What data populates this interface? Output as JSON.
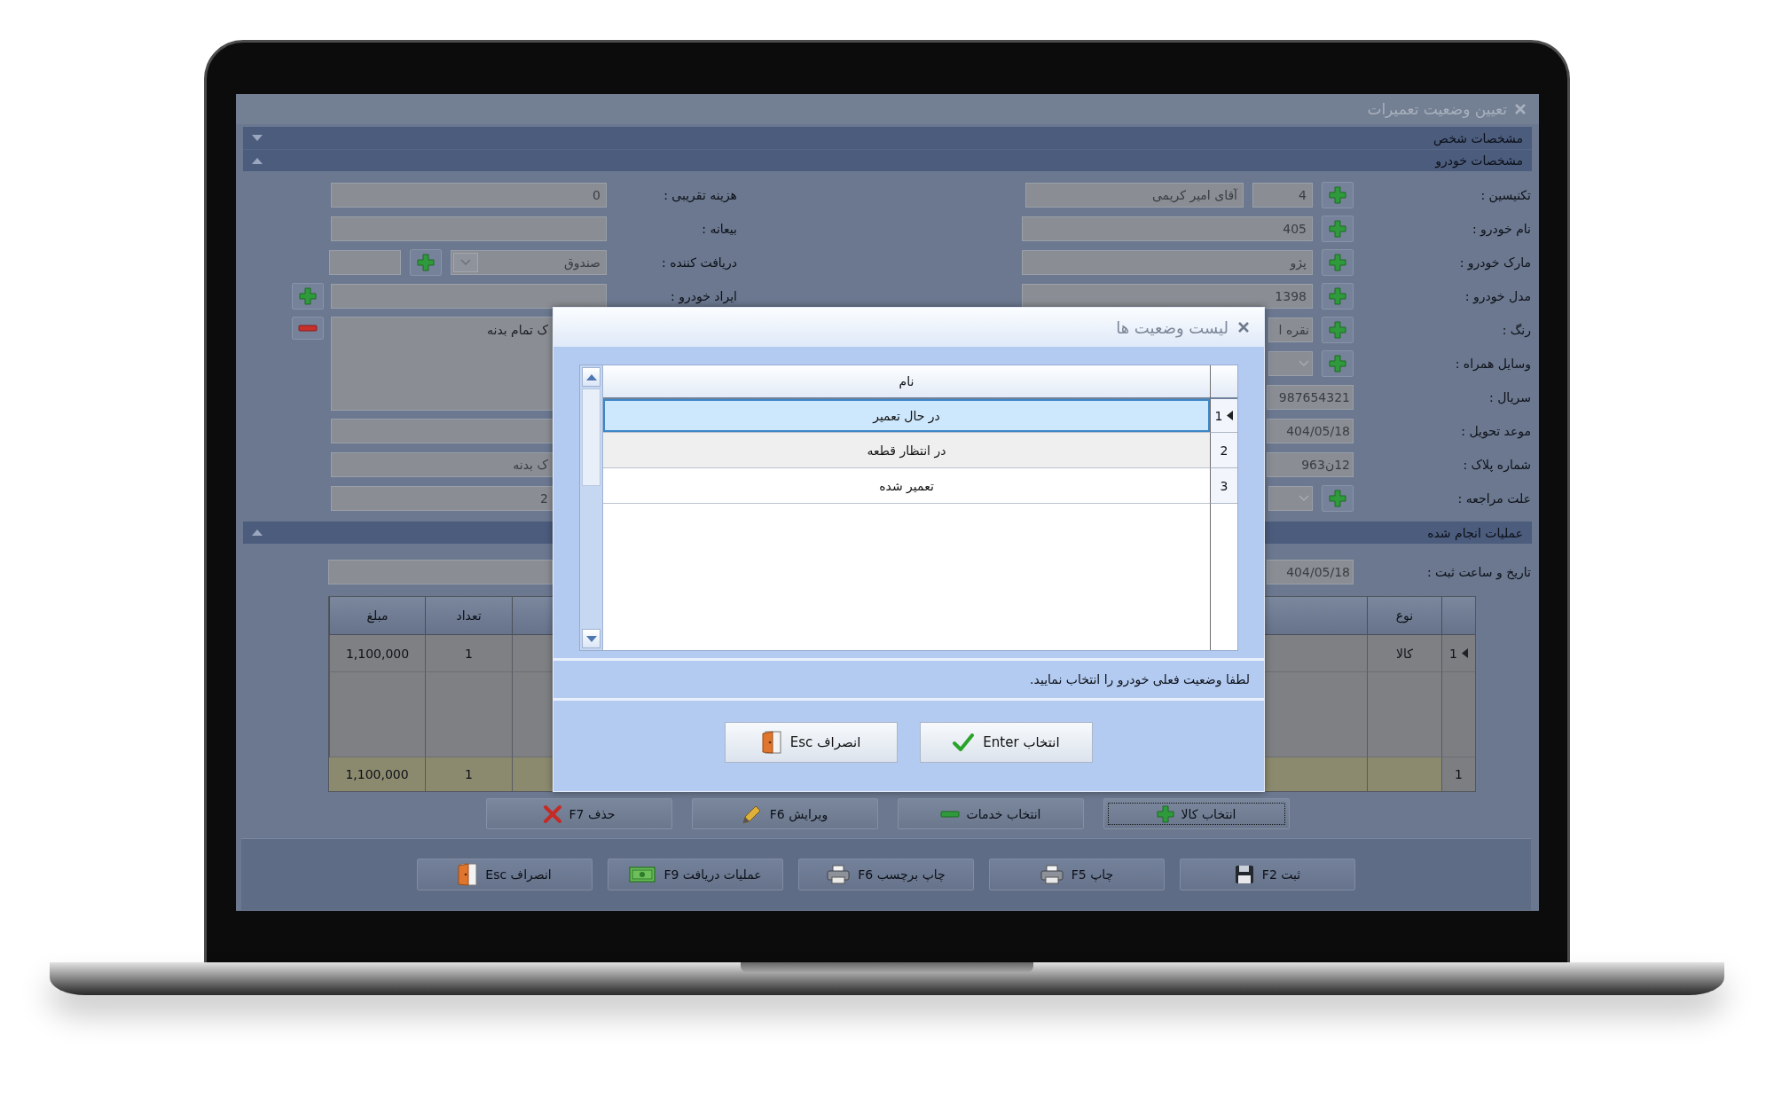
{
  "window": {
    "title": "تعیین وضعیت تعمیرات"
  },
  "sections": [
    {
      "title": "مشخصات شخص",
      "expanded": false
    },
    {
      "title": "مشخصات خودرو",
      "expanded": true
    }
  ],
  "vehicle": {
    "right": [
      {
        "label": "تکنیسین :",
        "kind": "code",
        "code": "4",
        "value": "آقای امیر کریمی",
        "add": true
      },
      {
        "label": "نام خودرو :",
        "kind": "text",
        "value": "405",
        "add": true
      },
      {
        "label": "مارک خودرو :",
        "kind": "text",
        "value": "پژو",
        "add": true
      },
      {
        "label": "مدل خودرو :",
        "kind": "text",
        "value": "1398",
        "add": true
      },
      {
        "label": "رنگ :",
        "kind": "text",
        "value": "نقره ا",
        "add": true
      },
      {
        "label": "وسایل همراه :",
        "kind": "combo",
        "add": true
      },
      {
        "label": "سریال :",
        "kind": "text",
        "value": "987654321",
        "add": false
      },
      {
        "label": "موعد تحویل :",
        "kind": "text",
        "value": "404/05/18",
        "add": false
      },
      {
        "label": "شماره پلاک :",
        "kind": "text",
        "value": "12ن963",
        "add": false
      },
      {
        "label": "علت مراجعه :",
        "kind": "combo",
        "add": true
      }
    ],
    "left": [
      {
        "label": "هزینه تقریبی :",
        "kind": "text",
        "value": "0",
        "add": false
      },
      {
        "label": "بیعانه :",
        "kind": "text",
        "add": false
      },
      {
        "label": "دریافت کننده :",
        "kind": "receiver",
        "value": "صندوق",
        "add": false
      },
      {
        "label": "ایراد خودرو :",
        "kind": "text",
        "add": true
      }
    ],
    "notes": {
      "value": "ک تمام بدنه",
      "removable": true
    },
    "more_fields": [
      {
        "kind": "blank"
      },
      {
        "kind": "text",
        "value": "ک بدنه"
      },
      {
        "kind": "text",
        "value": "2"
      }
    ]
  },
  "operations": {
    "title": "عملیات انجام شده",
    "expanded": true,
    "date_label": "تاریخ و ساعت ثبت :",
    "date_value": "404/05/18",
    "columns": [
      {
        "kind": "label",
        "label": "نوع"
      },
      {
        "kind": "blank"
      },
      {
        "kind": "blank"
      },
      {
        "kind": "label",
        "label": "تعداد"
      },
      {
        "kind": "label",
        "label": "مبلغ"
      }
    ],
    "rows": [
      {
        "number": "1",
        "selected": true,
        "cells": [
          {
            "kind": "text",
            "text": "کالا"
          },
          {
            "kind": "blank"
          },
          {
            "kind": "blank"
          },
          {
            "kind": "text",
            "text": "1"
          },
          {
            "kind": "text",
            "text": "1,100,000"
          }
        ]
      }
    ],
    "footer": {
      "number": "1",
      "cells": [
        {
          "kind": "blank"
        },
        {
          "kind": "blank"
        },
        {
          "kind": "blank"
        },
        {
          "kind": "text",
          "text": "1"
        },
        {
          "kind": "text",
          "text": "1,100,000"
        }
      ]
    },
    "buttons": [
      {
        "label": "انتخاب کالا",
        "kind": "add",
        "focused": true
      },
      {
        "label": "انتخاب خدمات",
        "kind": "services",
        "focused": false
      },
      {
        "label": "ویرایش F6",
        "kind": "edit",
        "focused": false
      },
      {
        "label": "حذف F7",
        "kind": "delete",
        "focused": false
      }
    ]
  },
  "actions": [
    {
      "label": "ثبت F2",
      "kind": "save"
    },
    {
      "label": "چاپ F5",
      "kind": "print"
    },
    {
      "label": "چاپ برچسب F6",
      "kind": "print"
    },
    {
      "label": "عملیات دریافت F9",
      "kind": "payment"
    },
    {
      "label": "انصراف Esc",
      "kind": "cancel"
    }
  ],
  "dialog": {
    "title": "لیست وضعیت ها",
    "column": "نام",
    "rows": [
      {
        "number": "1",
        "name": "در حال تعمیر",
        "selected": true
      },
      {
        "number": "2",
        "name": "در انتظار قطعه",
        "selected": false
      },
      {
        "number": "3",
        "name": "تعمیر شده",
        "selected": false
      }
    ],
    "message": "لطفا وضعیت فعلی خودرو را انتخاب نمایید.",
    "buttons": [
      {
        "label": "انتخاب Enter",
        "kind": "confirm"
      },
      {
        "label": "انصراف Esc",
        "kind": "cancel"
      }
    ]
  }
}
